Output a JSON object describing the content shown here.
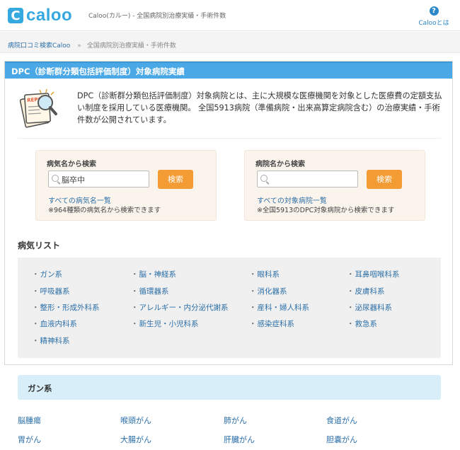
{
  "header": {
    "logo_letter": "C",
    "logo_text": "caloo",
    "tagline": "Caloo(カルー) - 全国病院別治療実績・手術件数",
    "help_icon": "?",
    "help_label": "Calooとは"
  },
  "breadcrumb": {
    "home": "病院口コミ検索Caloo",
    "separator": "»",
    "current": "全国病院別治療実績・手術件数"
  },
  "panel": {
    "title": "DPC（診断群分類包括評価制度）対象病院実績",
    "intro": "DPC（診断群分類包括評価制度）対象病院とは、主に大規模な医療機関を対象とした医療費の定額支払い制度を採用している医療機関。 全国5913病院（準備病院・出来高算定病院含む）の治療実績・手術件数が公開されています。",
    "intro_icon": "report-magnifier-illustration"
  },
  "search_disease": {
    "title": "病気名から検索",
    "value": "脳卒中",
    "button": "検索",
    "link": "すべての病気名一覧",
    "note": "※964種類の病気名から検索できます"
  },
  "search_hospital": {
    "title": "病院名から検索",
    "value": "",
    "button": "検索",
    "link": "すべての対象病院一覧",
    "note": "※全国5913のDPC対象病院から検索できます"
  },
  "disease_list": {
    "title": "病気リスト",
    "items": [
      "ガン系",
      "脳・神経系",
      "眼科系",
      "耳鼻咽喉科系",
      "呼吸器系",
      "循環器系",
      "消化器系",
      "皮膚科系",
      "整形・形成外科系",
      "アレルギー・内分泌代謝系",
      "産科・婦人科系",
      "泌尿器科系",
      "血液内科系",
      "新生児・小児科系",
      "感染症科系",
      "救急系",
      "精神科系"
    ]
  },
  "section": {
    "title": "ガン系",
    "diseases": [
      "脳腫瘍",
      "喉頭がん",
      "肺がん",
      "食道がん",
      "胃がん",
      "大腸がん",
      "肝臓がん",
      "胆嚢がん"
    ]
  },
  "colors": {
    "brand": "#36a8e0",
    "panel_header": "#4aa8e6",
    "search_button": "#f39c33",
    "link": "#2c6fa8",
    "section_bar": "#d8effa"
  }
}
